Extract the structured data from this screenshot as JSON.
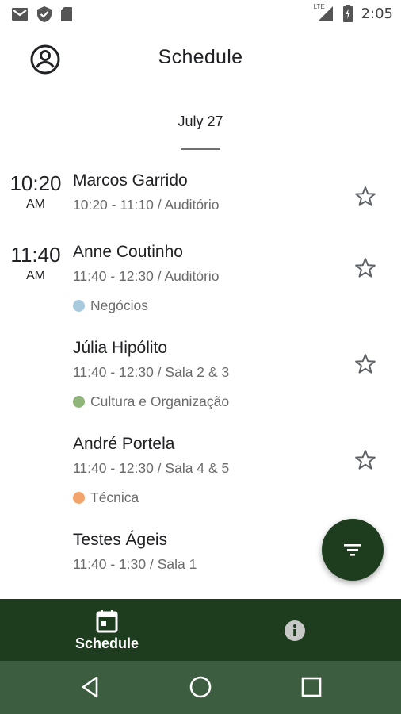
{
  "status_bar": {
    "time": "2:05",
    "network": "LTE",
    "left_icons": [
      "gmail-icon",
      "shield-check-icon",
      "sd-card-icon"
    ]
  },
  "header": {
    "title": "Schedule",
    "account_icon": "account-circle-icon"
  },
  "date_tabs": [
    {
      "label": "July 27",
      "selected": true
    }
  ],
  "time_slots": [
    {
      "time": "10:20",
      "ampm": "AM"
    },
    {
      "time": "11:40",
      "ampm": "AM"
    }
  ],
  "sessions": [
    {
      "title": "Marcos Garrido",
      "meta": "10:20 - 11:10 / Auditório",
      "tag": null,
      "starred": false
    },
    {
      "title": "Anne Coutinho",
      "meta": "11:40 - 12:30 / Auditório",
      "tag": {
        "label": "Negócios",
        "color": "#a9c9dc"
      },
      "starred": false
    },
    {
      "title": "Júlia Hipólito",
      "meta": "11:40 - 12:30 / Sala 2 & 3",
      "tag": {
        "label": "Cultura e Organização",
        "color": "#8fb57a"
      },
      "starred": false
    },
    {
      "title": "André Portela",
      "meta": "11:40 - 12:30 / Sala 4 & 5",
      "tag": {
        "label": "Técnica",
        "color": "#f2a46b"
      },
      "starred": false
    },
    {
      "title": "Testes Ágeis",
      "meta": "11:40 - 1:30 / Sala 1",
      "tag": null,
      "starred": false
    }
  ],
  "fab": {
    "icon": "filter-list-icon",
    "color": "#1e3d1f"
  },
  "bottom_nav": {
    "background": "#1e3d1f",
    "items": [
      {
        "label": "Schedule",
        "icon": "calendar-today-icon",
        "selected": true
      },
      {
        "label": "",
        "icon": "info-icon",
        "selected": false
      }
    ]
  },
  "system_nav": {
    "background": "#3d5d40",
    "buttons": [
      "back-icon",
      "home-icon",
      "recents-icon"
    ]
  }
}
